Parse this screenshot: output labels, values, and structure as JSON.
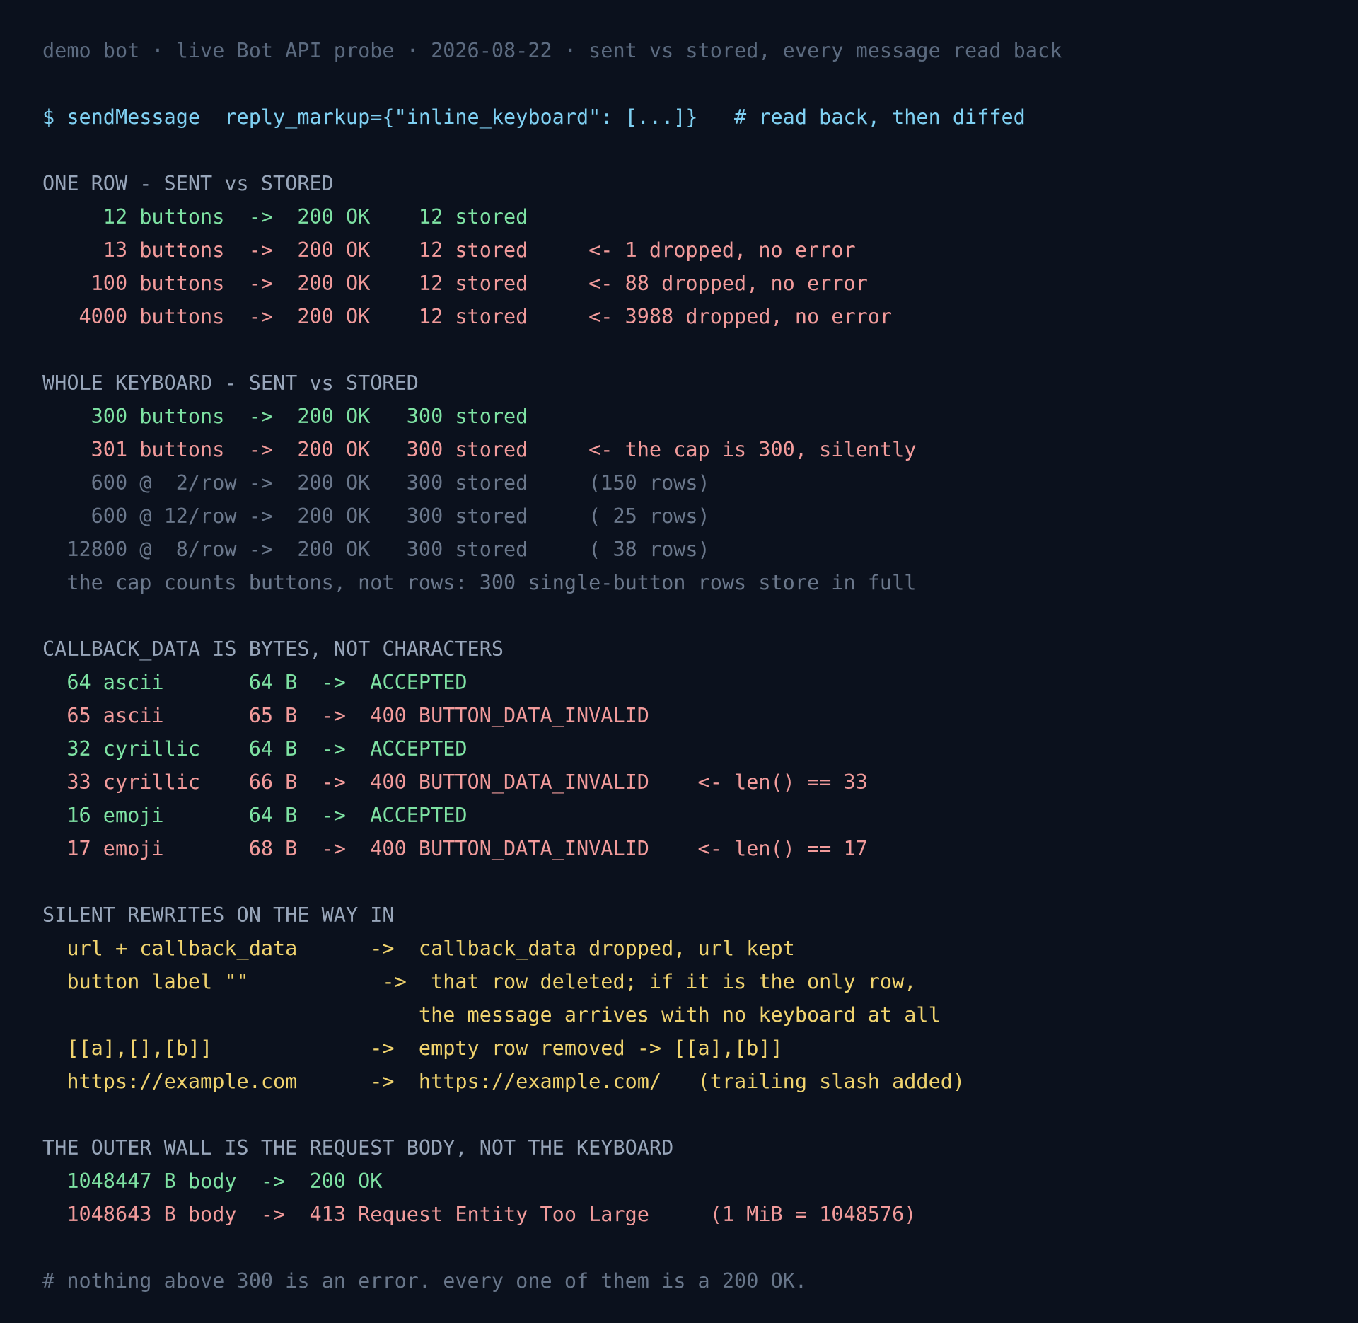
{
  "header": {
    "title_line": "demo bot · live Bot API probe · 2026-08-22 · sent vs stored, every message read back",
    "command_line": "$ sendMessage  reply_markup={\"inline_keyboard\": [...]}   # read back, then diffed"
  },
  "sections": {
    "one_row": {
      "heading": "ONE ROW - SENT vs STORED",
      "lines": [
        "     12 buttons  ->  200 OK    12 stored",
        "     13 buttons  ->  200 OK    12 stored     <- 1 dropped, no error",
        "    100 buttons  ->  200 OK    12 stored     <- 88 dropped, no error",
        "   4000 buttons  ->  200 OK    12 stored     <- 3988 dropped, no error"
      ]
    },
    "whole_keyboard": {
      "heading": "WHOLE KEYBOARD - SENT vs STORED",
      "lines": [
        "    300 buttons  ->  200 OK   300 stored",
        "    301 buttons  ->  200 OK   300 stored     <- the cap is 300, silently",
        "    600 @  2/row ->  200 OK   300 stored     (150 rows)",
        "    600 @ 12/row ->  200 OK   300 stored     ( 25 rows)",
        "  12800 @  8/row ->  200 OK   300 stored     ( 38 rows)",
        "  the cap counts buttons, not rows: 300 single-button rows store in full"
      ]
    },
    "callback_data": {
      "heading": "CALLBACK_DATA IS BYTES, NOT CHARACTERS",
      "lines": [
        "  64 ascii       64 B  ->  ACCEPTED",
        "  65 ascii       65 B  ->  400 BUTTON_DATA_INVALID",
        "  32 cyrillic    64 B  ->  ACCEPTED",
        "  33 cyrillic    66 B  ->  400 BUTTON_DATA_INVALID    <- len() == 33",
        "  16 emoji       64 B  ->  ACCEPTED",
        "  17 emoji       68 B  ->  400 BUTTON_DATA_INVALID    <- len() == 17"
      ]
    },
    "silent_rewrites": {
      "heading": "SILENT REWRITES ON THE WAY IN",
      "lines": [
        "  url + callback_data      ->  callback_data dropped, url kept",
        "  button label \"\"           ->  that row deleted; if it is the only row,",
        "                               the message arrives with no keyboard at all",
        "  [[a],[],[b]]             ->  empty row removed -> [[a],[b]]",
        "  https://example.com      ->  https://example.com/   (trailing slash added)"
      ]
    },
    "outer_wall": {
      "heading": "THE OUTER WALL IS THE REQUEST BODY, NOT THE KEYBOARD",
      "lines": [
        "  1048447 B body  ->  200 OK",
        "  1048643 B body  ->  413 Request Entity Too Large     (1 MiB = 1048576)"
      ]
    }
  },
  "footer": {
    "note": "# nothing above 300 is an error. every one of them is a 200 OK."
  },
  "colors": {
    "background": "#0b111d",
    "command": "#7fd0f2",
    "heading": "#98a6ba",
    "ok_green": "#7ee2a3",
    "error_red": "#f29b9b",
    "rewrite_yellow": "#f0d36e",
    "dim_gray": "#6b788c"
  }
}
